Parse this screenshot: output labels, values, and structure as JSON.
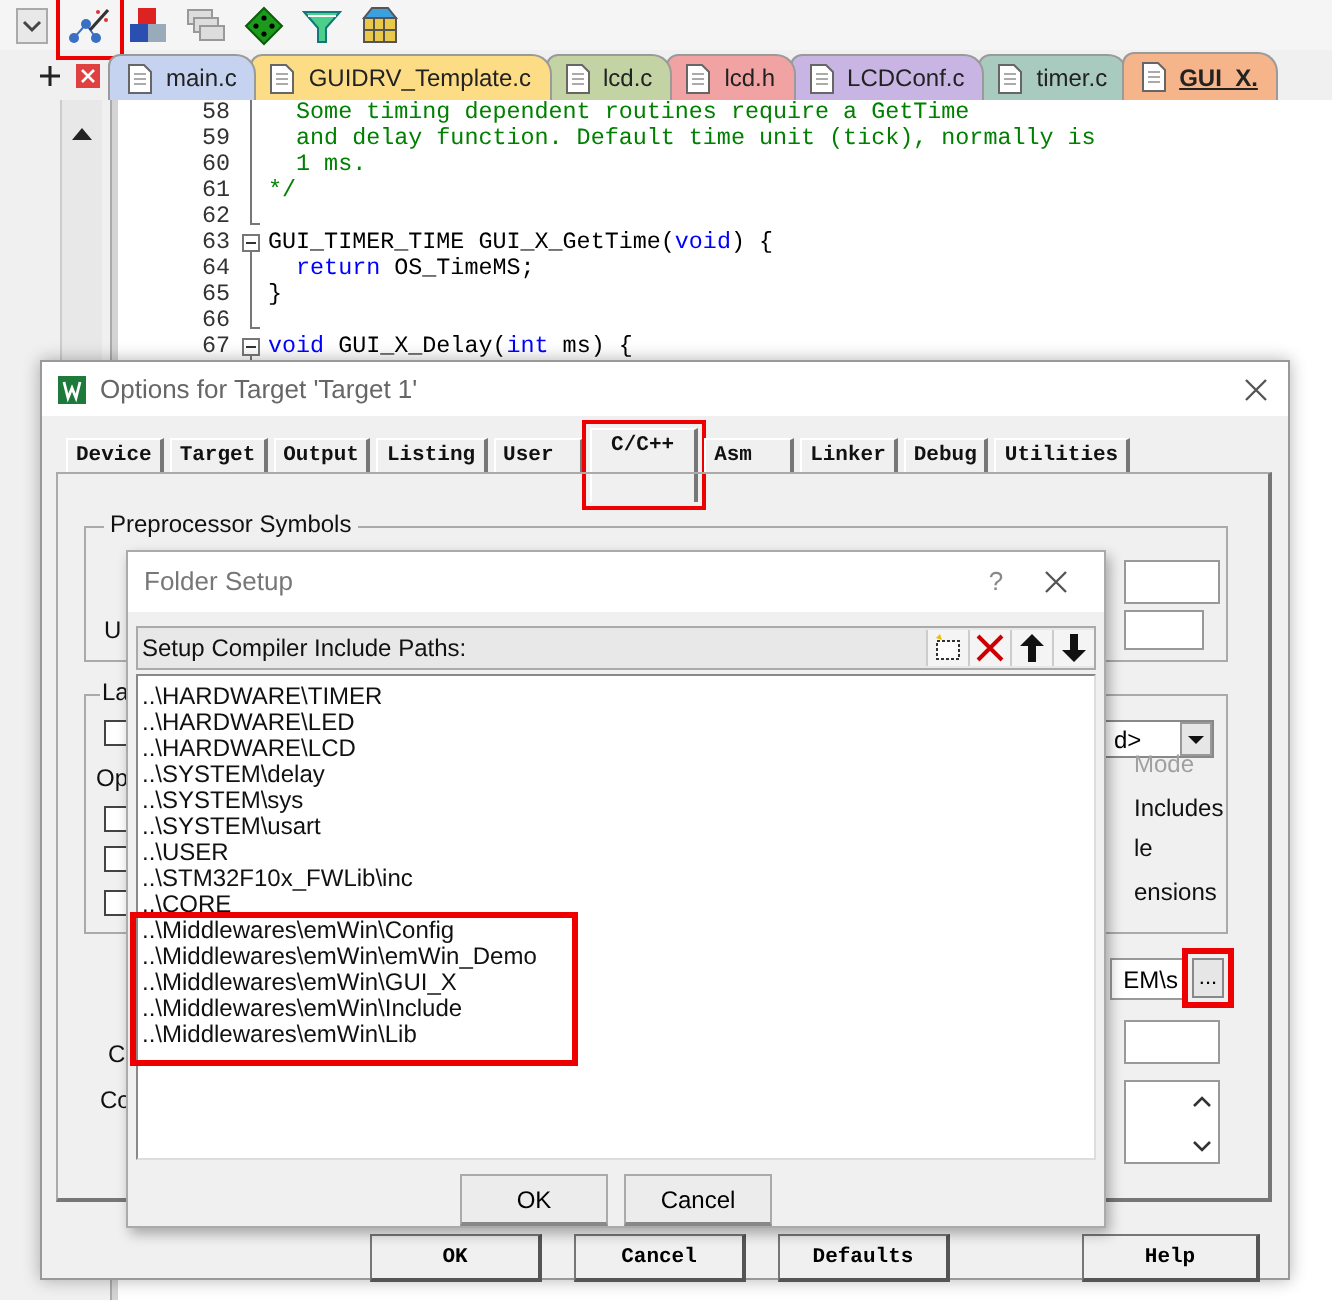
{
  "toolbar": [
    {
      "kind": "dropdown",
      "highlighted": false
    },
    {
      "kind": "wizard",
      "highlighted": true
    },
    {
      "kind": "blocks",
      "highlighted": false
    },
    {
      "kind": "stack",
      "highlighted": false
    },
    {
      "kind": "diamond",
      "highlighted": false
    },
    {
      "kind": "funnel",
      "highlighted": false
    },
    {
      "kind": "grid",
      "highlighted": false
    }
  ],
  "editor_tabs": [
    {
      "label": "main.c",
      "color": "#c5d3f0",
      "selected": false
    },
    {
      "label": "GUIDRV_Template.c",
      "color": "#fddc86",
      "selected": false
    },
    {
      "label": "lcd.c",
      "color": "#c3d3a3",
      "selected": false
    },
    {
      "label": "lcd.h",
      "color": "#f1a3a3",
      "selected": false
    },
    {
      "label": "LCDConf.c",
      "color": "#c9b5e3",
      "selected": false
    },
    {
      "label": "timer.c",
      "color": "#a9cbbf",
      "selected": false
    },
    {
      "label": "GUI_X.",
      "color": "#f6b48b",
      "selected": true
    }
  ],
  "code_lines": [
    {
      "number": "58",
      "kind": "fold_line",
      "segments": [
        {
          "kind": "comment",
          "text": "  Some timing dependent routines require a GetTime"
        }
      ]
    },
    {
      "number": "59",
      "kind": "fold_line",
      "segments": [
        {
          "kind": "comment",
          "text": "  and delay function. Default time unit (tick), normally is"
        }
      ]
    },
    {
      "number": "60",
      "kind": "fold_line",
      "segments": [
        {
          "kind": "comment",
          "text": "  1 ms."
        }
      ]
    },
    {
      "number": "61",
      "kind": "fold_line",
      "segments": [
        {
          "kind": "comment",
          "text": "*/"
        }
      ]
    },
    {
      "number": "62",
      "kind": "fold_end"
    },
    {
      "number": "63",
      "kind": "fold_open",
      "segments": [
        {
          "kind": "plain",
          "text": "GUI_TIMER_TIME GUI_X_GetTime("
        },
        {
          "kind": "keyword",
          "text": "void"
        },
        {
          "kind": "plain",
          "text": ") {"
        }
      ]
    },
    {
      "number": "64",
      "kind": "fold_line",
      "segments": [
        {
          "kind": "keyword",
          "text": "  return"
        },
        {
          "kind": "plain",
          "text": " OS_TimeMS;"
        }
      ]
    },
    {
      "number": "65",
      "kind": "fold_line",
      "segments": [
        {
          "kind": "plain",
          "text": "}"
        }
      ]
    },
    {
      "number": "66",
      "kind": "fold_end"
    },
    {
      "number": "67",
      "kind": "fold_open",
      "segments": [
        {
          "kind": "keyword",
          "text": "void"
        },
        {
          "kind": "plain",
          "text": " GUI_X_Delay("
        },
        {
          "kind": "keyword",
          "text": "int"
        },
        {
          "kind": "plain",
          "text": " ms) {"
        }
      ]
    }
  ],
  "options_dialog": {
    "title": "Options for Target 'Target 1'",
    "tabs": [
      {
        "label": "Device",
        "selected": false,
        "highlighted": false
      },
      {
        "label": "Target",
        "selected": false,
        "highlighted": false
      },
      {
        "label": "Output",
        "selected": false,
        "highlighted": false
      },
      {
        "label": "Listing",
        "selected": false,
        "highlighted": false
      },
      {
        "label": "User",
        "selected": false,
        "highlighted": false
      },
      {
        "label": "C/C++",
        "selected": true,
        "highlighted": true
      },
      {
        "label": "Asm",
        "selected": false,
        "highlighted": false
      },
      {
        "label": "Linker",
        "selected": false,
        "highlighted": false
      },
      {
        "label": "Debug",
        "selected": false,
        "highlighted": false
      },
      {
        "label": "Utilities",
        "selected": false,
        "highlighted": false
      }
    ],
    "preprocessor_label": "Preprocessor Symbols",
    "left_labels": [
      "U",
      "La",
      "Op",
      "C",
      "Co"
    ],
    "checkboxes": [
      {
        "checked": false
      },
      {
        "checked": false
      },
      {
        "checked": false
      },
      {
        "checked": false
      }
    ],
    "dropdown_value": "d>",
    "right_options": [
      {
        "text": "Mode",
        "disabled": true
      },
      {
        "text": "Includes",
        "disabled": false
      },
      {
        "text": "le",
        "disabled": false
      },
      {
        "text": "ensions",
        "disabled": false
      }
    ],
    "include_paths_value": "EM\\s",
    "browse_button": {
      "label": "...",
      "highlighted": true
    },
    "buttons": [
      "OK",
      "Cancel",
      "Defaults",
      "Help"
    ]
  },
  "folder_setup": {
    "title": "Folder Setup",
    "help": "?",
    "header": "Setup Compiler Include Paths:",
    "path_groups": [
      {
        "highlighted": false,
        "paths": [
          "..\\HARDWARE\\TIMER",
          "..\\HARDWARE\\LED",
          "..\\HARDWARE\\LCD",
          "..\\SYSTEM\\delay",
          "..\\SYSTEM\\sys",
          "..\\SYSTEM\\usart",
          "..\\USER",
          "..\\STM32F10x_FWLib\\inc",
          "..\\CORE"
        ]
      },
      {
        "highlighted": true,
        "paths": [
          "..\\Middlewares\\emWin\\Config",
          "..\\Middlewares\\emWin\\emWin_Demo",
          "..\\Middlewares\\emWin\\GUI_X",
          "..\\Middlewares\\emWin\\Include",
          "..\\Middlewares\\emWin\\Lib"
        ]
      }
    ],
    "buttons": [
      "OK",
      "Cancel"
    ]
  }
}
